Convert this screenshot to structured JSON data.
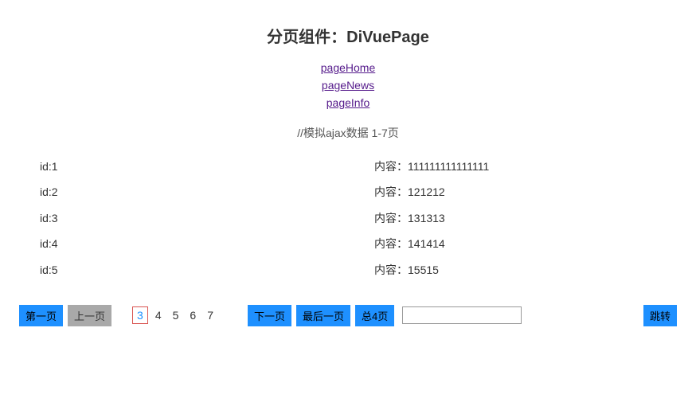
{
  "title": "分页组件：DiVuePage",
  "nav": {
    "items": [
      {
        "label": "pageHome"
      },
      {
        "label": "pageNews"
      },
      {
        "label": "pageInfo"
      }
    ]
  },
  "mock_note": "//模拟ajax数据 1-7页",
  "rows": [
    {
      "id_label": "id:1",
      "content_label": "内容：111111111111111"
    },
    {
      "id_label": "id:2",
      "content_label": "内容：121212"
    },
    {
      "id_label": "id:3",
      "content_label": "内容：131313"
    },
    {
      "id_label": "id:4",
      "content_label": "内容：141414"
    },
    {
      "id_label": "id:5",
      "content_label": "内容：15515"
    }
  ],
  "pagination": {
    "first_label": "第一页",
    "prev_label": "上一页",
    "next_label": "下一页",
    "last_label": "最后一页",
    "total_label": "总4页",
    "jump_label": "跳转",
    "current_page": "3",
    "pages": [
      "3",
      "4",
      "5",
      "6",
      "7"
    ],
    "jump_value": ""
  }
}
